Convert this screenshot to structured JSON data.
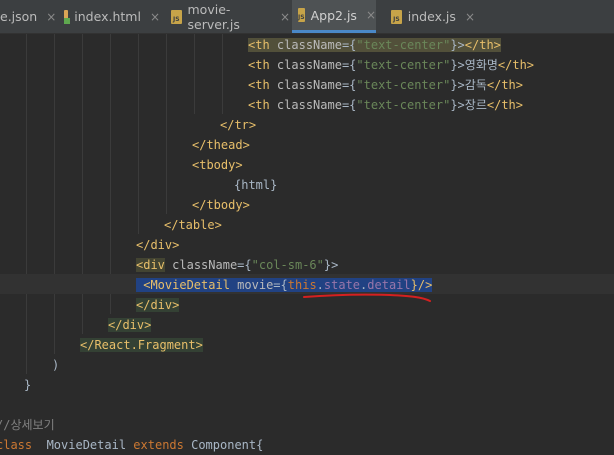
{
  "tabs": [
    {
      "label": "e.json",
      "icon": "json-file-icon"
    },
    {
      "label": "index.html",
      "icon": "html-file-icon"
    },
    {
      "label": "movie-server.js",
      "icon": "js-file-icon"
    },
    {
      "label": "App2.js",
      "icon": "js-file-icon",
      "active": true
    },
    {
      "label": "index.js",
      "icon": "js-file-icon"
    }
  ],
  "tab_close": "×",
  "js_badge": "JS",
  "code": {
    "th": "<th",
    "th_close": "</th>",
    "classname_attr": "className",
    "eq_open": "={",
    "text_center": "\"text-center\"",
    "close_brace_gt": "}>",
    "heading_1": "영화명",
    "heading_2": "감독",
    "heading_3": "장르",
    "tr_close": "</tr>",
    "thead_close": "</thead>",
    "tbody_open": "<tbody>",
    "html_expr": "{html}",
    "tbody_close": "</tbody>",
    "table_close": "</table>",
    "div_close": "</div>",
    "div_open": "<div",
    "col_sm_6": "\"col-sm-6\"",
    "movie_detail_open": "<MovieDetail",
    "movie_attr": "movie",
    "eq": "=",
    "lbrace": "{",
    "this_kw": "this",
    "dot": ".",
    "state_fld": "state",
    "detail_fld": "detail",
    "self_close": "}/>",
    "fragment_close": "</React.Fragment>",
    "paren_close": ")",
    "rbrace": "}",
    "comment": "//상세보기",
    "class_kw": "class",
    "class_name": "MovieDetail",
    "extends_kw": "extends",
    "component": "Component{"
  },
  "colors": {
    "background": "#2b2b2b",
    "tag": "#e8bf6a",
    "string": "#6a8759",
    "keyword": "#cc7832",
    "field": "#9876aa",
    "selection": "#214283",
    "annotation_underline": "#d42020"
  }
}
